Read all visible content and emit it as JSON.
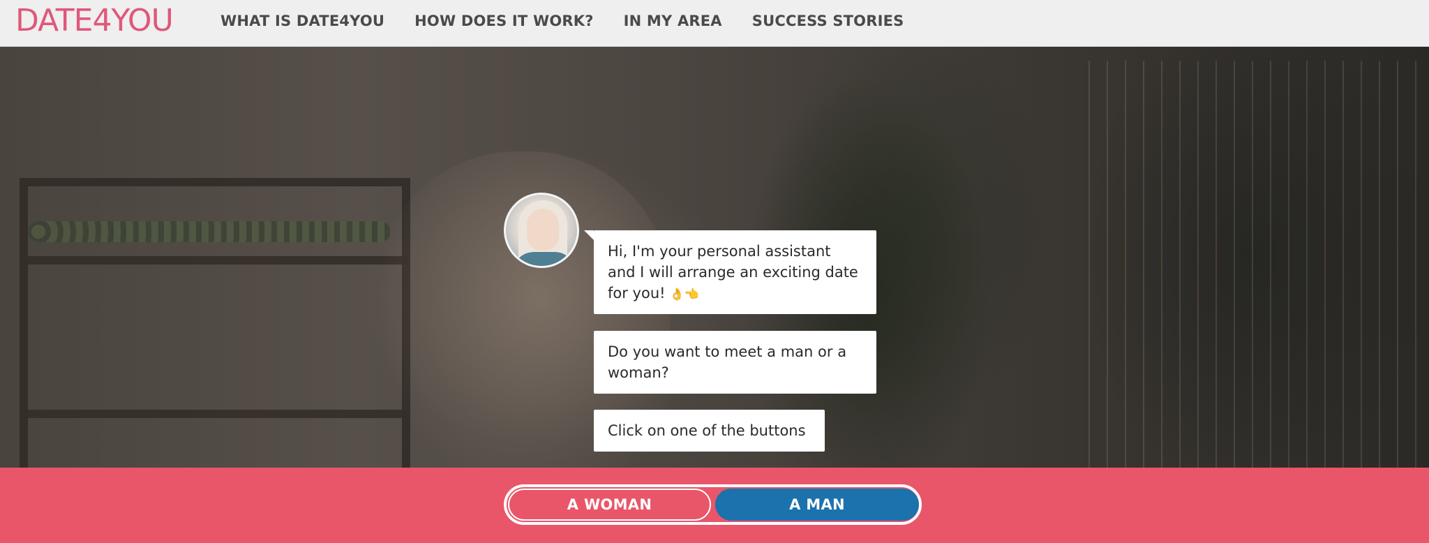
{
  "brand": {
    "logo": "DATE4YOU"
  },
  "nav": {
    "items": [
      {
        "label": "WHAT IS DATE4YOU"
      },
      {
        "label": "HOW DOES IT WORK?"
      },
      {
        "label": "IN MY AREA"
      },
      {
        "label": "SUCCESS STORIES"
      }
    ]
  },
  "chat": {
    "messages": [
      {
        "text": "Hi, I'm your personal assistant and I will arrange an exciting date for you!",
        "emoji": "👌👈"
      },
      {
        "text": "Do you want to meet a man or a woman?"
      },
      {
        "text": "Click on one of the buttons"
      }
    ]
  },
  "choices": {
    "woman_label": "A WOMAN",
    "man_label": "A MAN"
  },
  "colors": {
    "brand_pink": "#e0577a",
    "bottom_bar": "#e9566a",
    "man_button": "#1b72ad",
    "header_bg": "#efefef"
  }
}
